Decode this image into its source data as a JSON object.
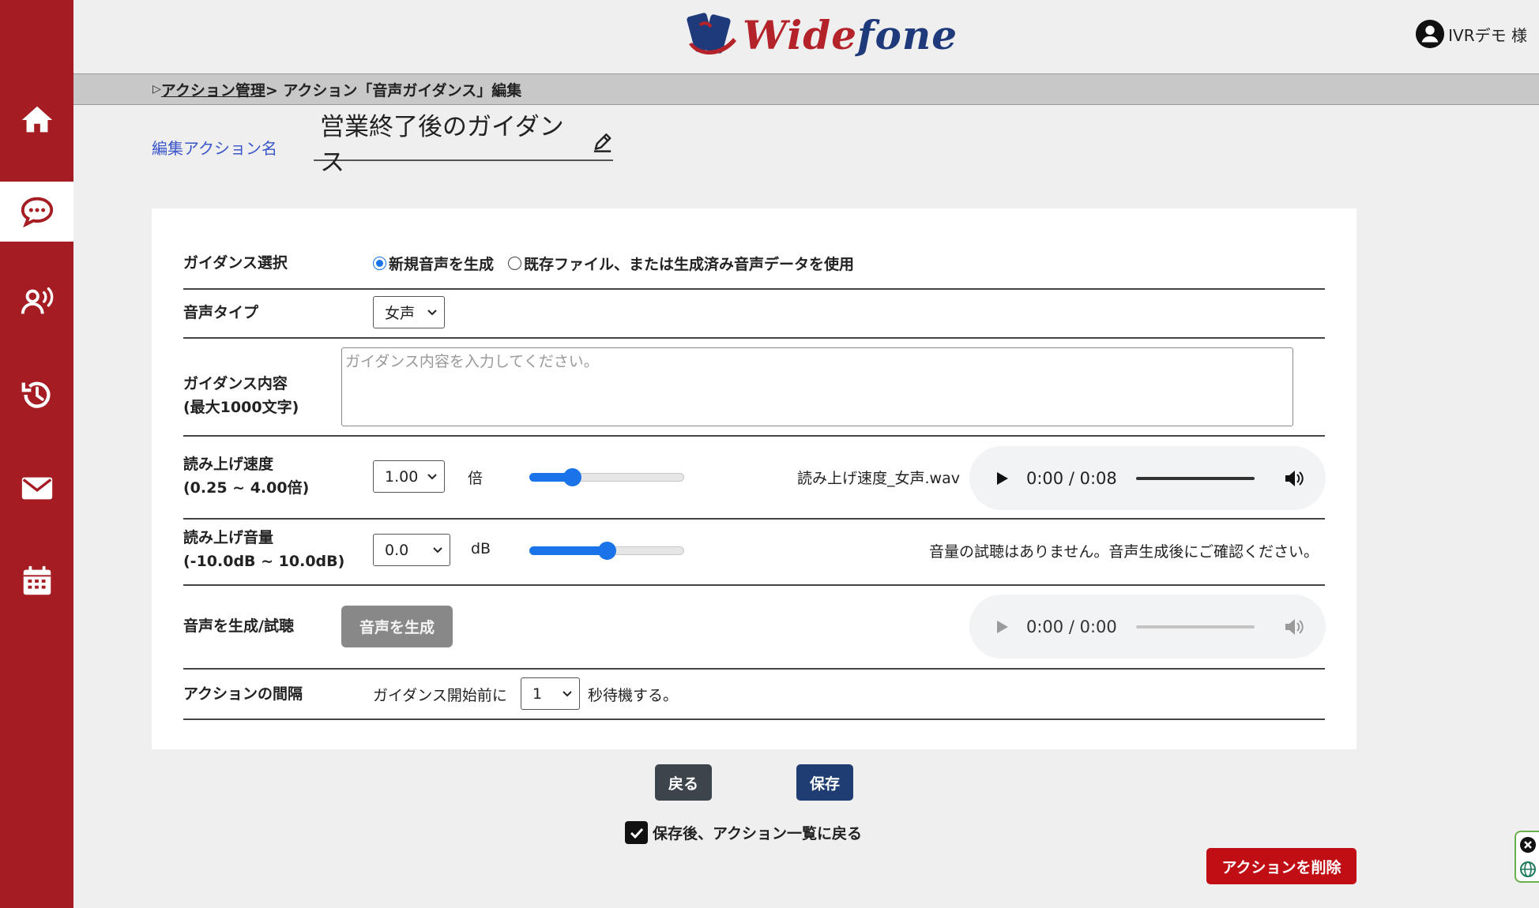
{
  "app": {
    "logo_text_1": "Wide",
    "logo_text_2": "fone",
    "user_name": "IVRデモ 様"
  },
  "sidebar": {
    "items": [
      {
        "icon": "home-icon",
        "active": false
      },
      {
        "icon": "chat-bubble-icon",
        "active": true
      },
      {
        "icon": "voice-user-icon",
        "active": false
      },
      {
        "icon": "history-icon",
        "active": false
      },
      {
        "icon": "mail-icon",
        "active": false
      },
      {
        "icon": "calendar-icon",
        "active": false
      }
    ]
  },
  "breadcrumb": {
    "prefix": "▷",
    "link": "アクション管理",
    "current": "> アクション「音声ガイダンス」編集"
  },
  "action_name": {
    "label": "編集アクション名",
    "value": "営業終了後のガイダンス"
  },
  "form": {
    "guidance_select": {
      "label": "ガイダンス選択",
      "options": [
        "新規音声を生成",
        "既存ファイル、または生成済み音声データを使用"
      ],
      "selected": "新規音声を生成"
    },
    "voice_type": {
      "label": "音声タイプ",
      "value": "女声"
    },
    "content": {
      "label_1": "ガイダンス内容",
      "label_2": "(最大1000文字)",
      "placeholder": "ガイダンス内容を入力してください。"
    },
    "speed": {
      "label_1": "読み上げ速度",
      "label_2": "(0.25 ~ 4.00倍)",
      "value": "1.00",
      "unit": "倍",
      "slider_fraction": 0.25,
      "file_name": "読み上げ速度_女声.wav",
      "audio_time": "0:00 / 0:08"
    },
    "volume": {
      "label_1": "読み上げ音量",
      "label_2": "(-10.0dB ~ 10.0dB)",
      "value": "0.0",
      "unit": "dB",
      "slider_fraction": 0.5,
      "note": "音量の試聴はありません。音声生成後にご確認ください。"
    },
    "generate": {
      "label": "音声を生成/試聴",
      "button": "音声を生成",
      "audio_time": "0:00 / 0:00"
    },
    "interval": {
      "label": "アクションの間隔",
      "prefix": "ガイダンス開始前に",
      "value": "1",
      "suffix": "秒待機する。"
    }
  },
  "buttons": {
    "back": "戻る",
    "save": "保存",
    "after_save_checkbox": "保存後、アクション一覧に戻る",
    "after_save_checked": true,
    "delete": "アクションを削除"
  },
  "colors": {
    "sidebar": "#a51d22",
    "accent_blue": "#1a73e8",
    "save_button": "#1f3d72",
    "back_button": "#3c444c",
    "delete_button": "#c10d14"
  }
}
